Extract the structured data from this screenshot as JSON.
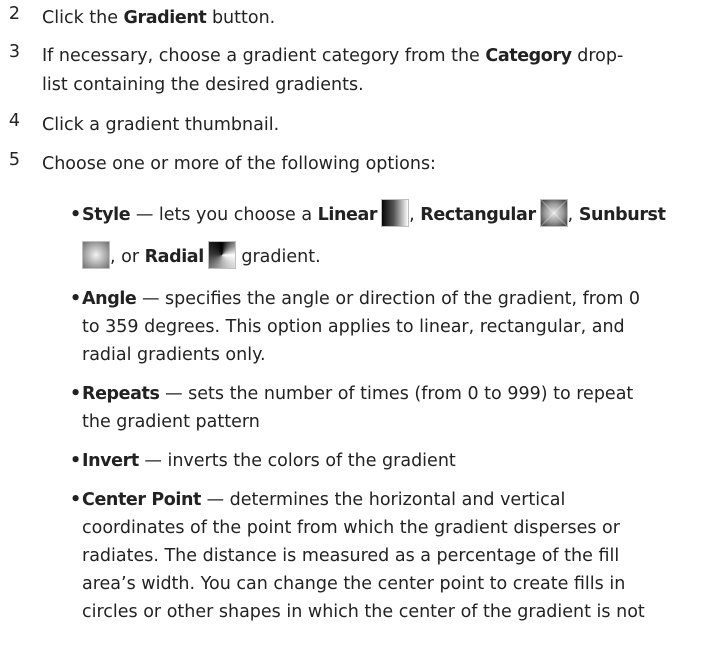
{
  "steps": [
    {
      "num": "2",
      "pre": "Click the ",
      "kw": "Gradient",
      "post": " button."
    },
    {
      "num": "3",
      "pre": "If necessary, choose a gradient category from the ",
      "kw": "Category",
      "post": " drop-",
      "line2": "list containing the desired gradients."
    },
    {
      "num": "4",
      "text": "Click a gradient thumbnail."
    },
    {
      "num": "5",
      "text": "Choose one or more of the following options:"
    }
  ],
  "options": {
    "style": {
      "term": "Style",
      "pre": " — lets you choose a ",
      "linear": "Linear",
      "comma1": ", ",
      "rectangular": "Rectangular",
      "comma2": ", ",
      "sunburst": "Sunburst",
      "comma3": ", or ",
      "radial": "Radial",
      "post": " gradient."
    },
    "angle": {
      "term": "Angle",
      "l1": " — specifies the angle or direction of the gradient, from 0",
      "l2": "to 359 degrees. This option applies to linear, rectangular, and",
      "l3": "radial gradients only."
    },
    "repeats": {
      "term": "Repeats",
      "l1": " — sets the number of times (from 0 to 999) to repeat",
      "l2": "the gradient pattern"
    },
    "invert": {
      "term": "Invert",
      "l1": " — inverts the colors of the gradient"
    },
    "center": {
      "term": "Center Point",
      "l1": " — determines the horizontal and vertical",
      "l2": "coordinates of the point from which the gradient disperses or",
      "l3": "radiates. The distance is measured as a percentage of the fill",
      "l4": "area’s width. You can change the center point to create fills in",
      "l5": "circles or other shapes in which the center of the gradient is not"
    }
  },
  "bullet_char": "•"
}
